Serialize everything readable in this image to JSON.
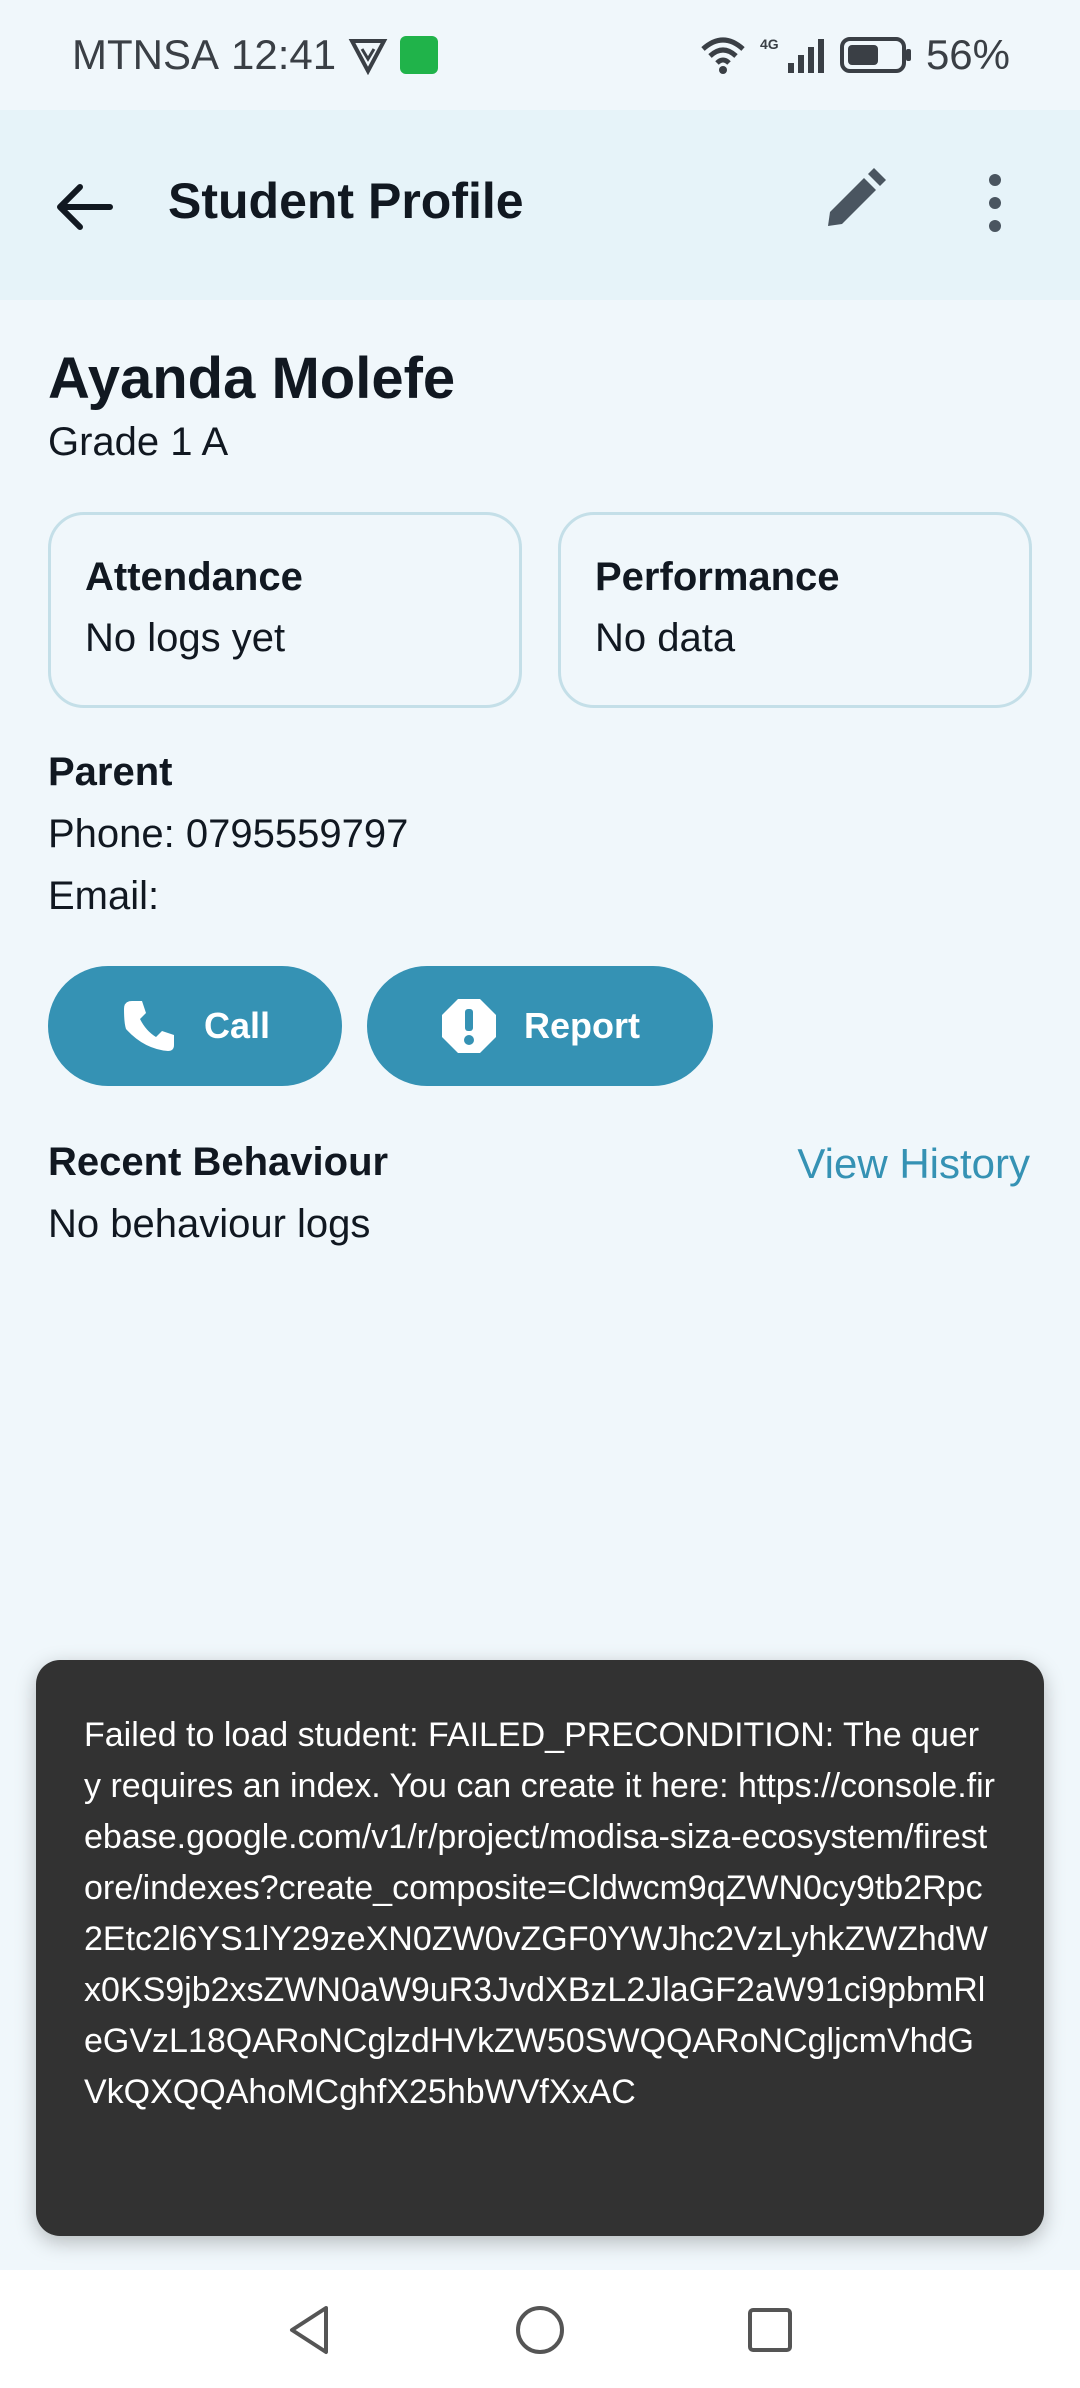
{
  "status_bar": {
    "carrier": "MTNSA",
    "time": "12:41",
    "network": "4G",
    "battery": "56%"
  },
  "app_bar": {
    "title": "Student Profile",
    "back_icon": "arrow-left-icon",
    "edit_icon": "pencil-icon",
    "more_icon": "more-vertical-icon"
  },
  "student": {
    "name": "Ayanda Molefe",
    "grade": "Grade 1 A"
  },
  "cards": {
    "attendance": {
      "title": "Attendance",
      "value": "No logs yet"
    },
    "performance": {
      "title": "Performance",
      "value": "No data"
    }
  },
  "parent": {
    "heading": "Parent",
    "phone": "Phone: 0795559797",
    "email": "Email:"
  },
  "actions": {
    "call_label": "Call",
    "call_icon": "phone-icon",
    "report_label": "Report",
    "report_icon": "alert-octagon-icon"
  },
  "behaviour": {
    "heading": "Recent Behaviour",
    "link": "View History",
    "empty": "No behaviour logs"
  },
  "snackbar": {
    "message": "Failed to load student: FAILED_PRECONDITION: The query requires an index. You can create it here: https://console.firebase.google.com/v1/r/project/modisa-siza-ecosystem/firestore/indexes?create_composite=Cldwcm9qZWN0cy9tb2Rpc2Etc2l6YS1lY29zeXN0ZW0vZGF0YWJhc2VzLyhkZWZhdWx0KS9jb2xsZWN0aW9uR3JvdXBzL2JlaGF2aW91ci9pbmRleGVzL18QARoNCglzdHVkZW50SWQQARoNCgljcmVhdGVkQXQQAhoMCghfX25hbWVfXxAC"
  },
  "colors": {
    "accent": "#3592b4",
    "background": "#f0f7fb",
    "appbar": "#e6f3f9",
    "snackbar": "#323232"
  }
}
